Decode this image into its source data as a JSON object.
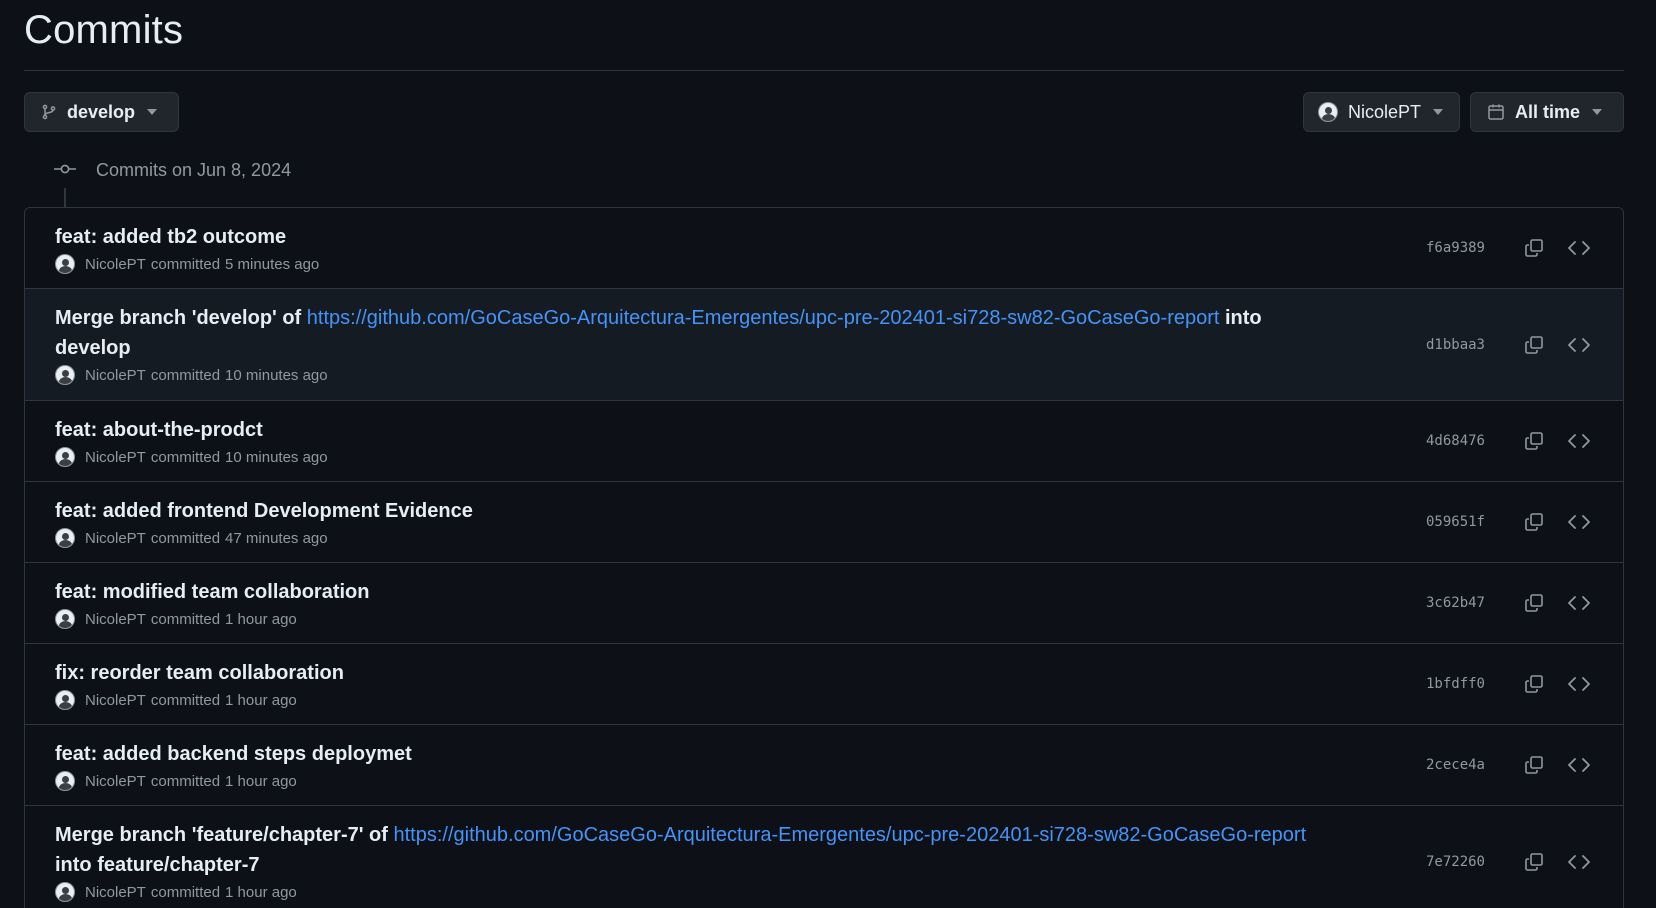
{
  "page": {
    "title": "Commits"
  },
  "filters": {
    "branch": {
      "label": "develop",
      "icon": "git-branch-icon"
    },
    "author": {
      "label": "NicolePT",
      "icon": "avatar"
    },
    "time": {
      "label": "All time",
      "icon": "calendar-icon"
    }
  },
  "group": {
    "header": "Commits on Jun 8, 2024",
    "icon": "git-commit-icon"
  },
  "colors": {
    "background": "#0d1117",
    "border": "#30363d",
    "link": "#4493f8",
    "muted": "#9198a1",
    "text": "#e6edf3"
  },
  "commits": [
    {
      "title": "feat: added tb2 outcome",
      "author": "NicolePT",
      "verb": "committed",
      "time": "5 minutes ago",
      "sha": "f6a9389"
    },
    {
      "title_prefix": "Merge branch 'develop' of ",
      "link": "https://github.com/GoCaseGo-Arquitectura-Emergentes/upc-pre-202401-si728-sw82-GoCaseGo-report",
      "title_suffix": " into develop",
      "author": "NicolePT",
      "verb": "committed",
      "time": "10 minutes ago",
      "sha": "d1bbaa3"
    },
    {
      "title": "feat: about-the-prodct",
      "author": "NicolePT",
      "verb": "committed",
      "time": "10 minutes ago",
      "sha": "4d68476"
    },
    {
      "title": "feat: added frontend Development Evidence",
      "author": "NicolePT",
      "verb": "committed",
      "time": "47 minutes ago",
      "sha": "059651f"
    },
    {
      "title": "feat: modified team collaboration",
      "author": "NicolePT",
      "verb": "committed",
      "time": "1 hour ago",
      "sha": "3c62b47"
    },
    {
      "title": "fix: reorder team collaboration",
      "author": "NicolePT",
      "verb": "committed",
      "time": "1 hour ago",
      "sha": "1bfdff0"
    },
    {
      "title": "feat: added backend steps deploymet",
      "author": "NicolePT",
      "verb": "committed",
      "time": "1 hour ago",
      "sha": "2cece4a"
    },
    {
      "title_prefix": "Merge branch 'feature/chapter-7' of ",
      "link": "https://github.com/GoCaseGo-Arquitectura-Emergentes/upc-pre-202401-si728-sw82-GoCaseGo-report",
      "title_suffix": " into feature/chapter-7",
      "author": "NicolePT",
      "verb": "committed",
      "time": "1 hour ago",
      "sha": "7e72260"
    }
  ]
}
